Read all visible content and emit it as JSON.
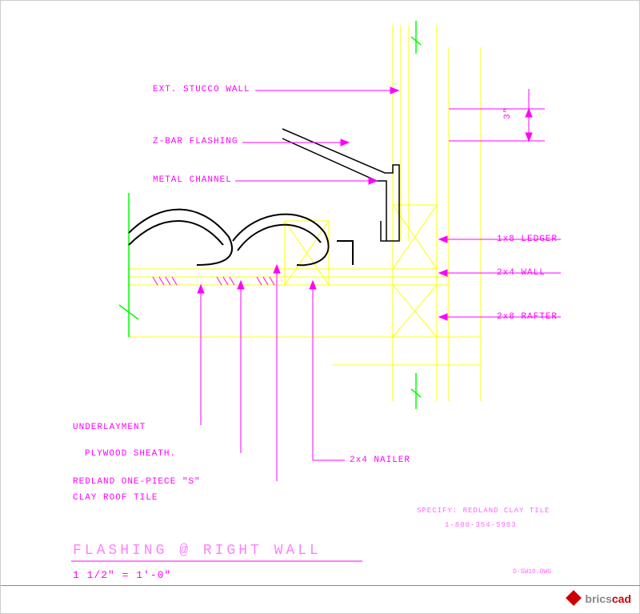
{
  "labels": {
    "ext_stucco": "EXT. STUCCO WALL",
    "z_bar": "Z-BAR FLASHING",
    "metal_channel": "METAL CHANNEL",
    "ledger": "1x8 LEDGER",
    "wall_2x4": "2x4 WALL",
    "rafter": "2x8 RAFTER",
    "nailer": "2x4 NAILER",
    "underlayment": "UNDERLAYMENT",
    "plywood": "PLYWOOD SHEATH.",
    "tile1": "REDLAND ONE-PIECE \"S\"",
    "tile2": "CLAY ROOF TILE",
    "dim3": "3\""
  },
  "title": "FLASHING  @  RIGHT  WALL",
  "scale": "1 1/2\" = 1'-0\"",
  "spec": "SPECIFY: REDLAND CLAY TILE",
  "phone": "1-800-354-5983",
  "dwg": "D-SW10.DWG",
  "brand": {
    "b": "brics",
    "c": "cad"
  },
  "colors": {
    "leader": "#ff00ff",
    "construction": "#ffff00",
    "break": "#00ff00",
    "profile": "#000000"
  }
}
